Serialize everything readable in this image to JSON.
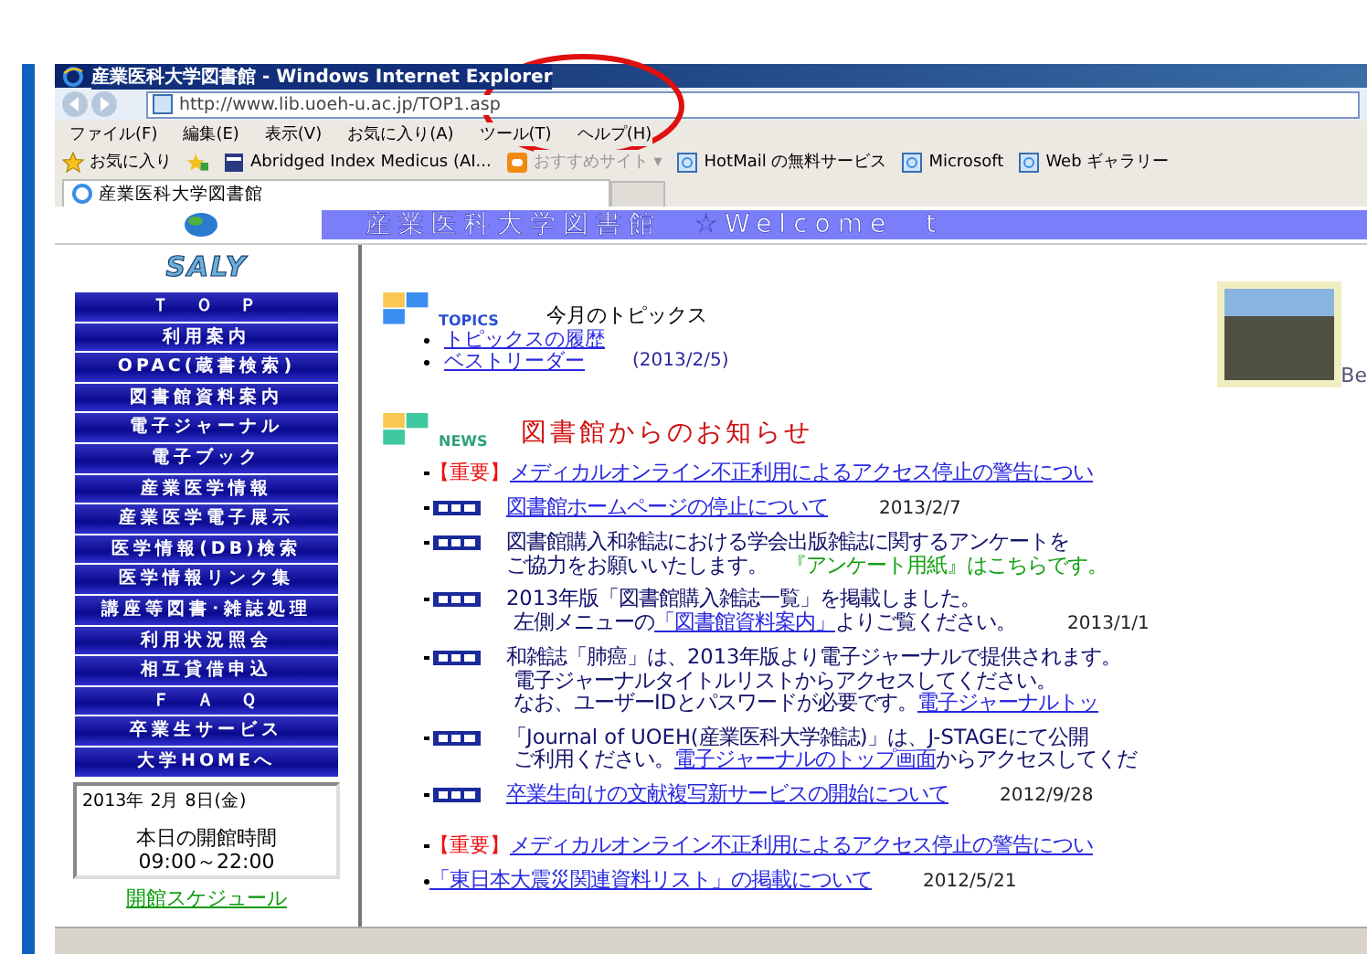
{
  "window": {
    "title": "産業医科大学図書館 - Windows Internet Explorer"
  },
  "address": "http://www.lib.uoeh-u.ac.jp/TOP1.asp",
  "menu": [
    "ファイル(F)",
    "編集(E)",
    "表示(V)",
    "お気に入り(A)",
    "ツール(T)",
    "ヘルプ(H)"
  ],
  "favorites_bar": [
    {
      "kind": "star",
      "label": "お気に入り"
    },
    {
      "kind": "add"
    },
    {
      "kind": "book",
      "label": "Abridged Index Medicus (AI..."
    },
    {
      "kind": "suggest",
      "label": "おすすめサイト ▾"
    },
    {
      "kind": "ie",
      "label": "HotMail の無料サービス"
    },
    {
      "kind": "ie",
      "label": "Microsoft"
    },
    {
      "kind": "ie",
      "label": "Web ギャラリー"
    }
  ],
  "tab": {
    "label": "産業医科大学図書館"
  },
  "banner": "産業医科大学図書館　☆Welcome　t",
  "sidebar": {
    "logo": "SALY",
    "items": [
      "Ｔ　Ｏ　Ｐ",
      "利用案内",
      "OPAC(蔵書検索)",
      "図書館資料案内",
      "電子ジャーナル",
      "電子ブック",
      "産業医学情報",
      "産業医学電子展示",
      "医学情報(DB)検索",
      "医学情報リンク集",
      "講座等図書･雑誌処理",
      "利用状況照会",
      "相互貸借申込",
      "Ｆ　Ａ　Ｑ",
      "卒業生サービス",
      "大学HOMEへ"
    ],
    "date": "2013年 2月 8日(金)",
    "hours_label": "本日の開館時間",
    "hours": "09:00～22:00",
    "schedule_link": "開館スケジュール"
  },
  "topics": {
    "badge": "TOPICS",
    "title": "今月のトピックス",
    "links": [
      {
        "label": "トピックスの履歴"
      },
      {
        "label": "ベストリーダー",
        "date": "(2013/2/5)"
      }
    ],
    "photo_caption": "Be"
  },
  "news": {
    "badge": "NEWS",
    "title": "図書館からのお知らせ",
    "items": [
      {
        "kind": "important",
        "tag": "【重要】",
        "lines": [
          [
            {
              "kind": "link",
              "text": "メディカルオンライン不正利用によるアクセス停止の警告につい"
            }
          ]
        ]
      },
      {
        "kind": "new",
        "lines": [
          [
            {
              "kind": "link",
              "text": "図書館ホームページの停止について"
            },
            {
              "kind": "date",
              "text": "2013/2/7"
            }
          ]
        ]
      },
      {
        "kind": "new",
        "lines": [
          [
            {
              "kind": "text",
              "text": "図書館購入和雑誌における学会出版雑誌に関するアンケートを"
            }
          ],
          [
            {
              "kind": "text",
              "text": "ご協力をお願いいたします。"
            },
            {
              "kind": "green",
              "text": "『アンケート用紙』はこちらです。"
            }
          ]
        ]
      },
      {
        "kind": "new",
        "lines": [
          [
            {
              "kind": "text",
              "text": "2013年版「図書館購入雑誌一覧」を掲載しました。"
            }
          ],
          [
            {
              "kind": "text",
              "text": "左側メニューの"
            },
            {
              "kind": "link",
              "text": "「図書館資料案内」"
            },
            {
              "kind": "text",
              "text": "よりご覧ください。"
            },
            {
              "kind": "date",
              "text": "2013/1/1"
            }
          ]
        ]
      },
      {
        "kind": "new",
        "lines": [
          [
            {
              "kind": "text",
              "text": "和雑誌「肺癌」は、2013年版より電子ジャーナルで提供されます。"
            }
          ],
          [
            {
              "kind": "text",
              "text": "電子ジャーナルタイトルリストからアクセスしてください。"
            }
          ],
          [
            {
              "kind": "text",
              "text": "なお、ユーザーIDとパスワードが必要です。"
            },
            {
              "kind": "link",
              "text": "電子ジャーナルトッ"
            }
          ]
        ]
      },
      {
        "kind": "new",
        "lines": [
          [
            {
              "kind": "text",
              "text": "「Journal of UOEH(産業医科大学雑誌)」は、J-STAGEにて公開"
            }
          ],
          [
            {
              "kind": "text",
              "text": "ご利用ください。"
            },
            {
              "kind": "link",
              "text": "電子ジャーナルのトップ画面"
            },
            {
              "kind": "text",
              "text": "からアクセスしてくだ"
            }
          ]
        ]
      },
      {
        "kind": "new",
        "lines": [
          [
            {
              "kind": "link",
              "text": "卒業生向けの文献複写新サービスの開始について"
            },
            {
              "kind": "date",
              "text": "2012/9/28"
            }
          ]
        ]
      },
      {
        "kind": "important",
        "tag": "【重要】",
        "lines": [
          [
            {
              "kind": "link",
              "text": "メディカルオンライン不正利用によるアクセス停止の警告につい"
            }
          ]
        ]
      },
      {
        "kind": "plain",
        "lines": [
          [
            {
              "kind": "link",
              "text": "「東日本大震災関連資料リスト」の掲載について"
            },
            {
              "kind": "date",
              "text": "2012/5/21"
            }
          ]
        ]
      }
    ]
  }
}
